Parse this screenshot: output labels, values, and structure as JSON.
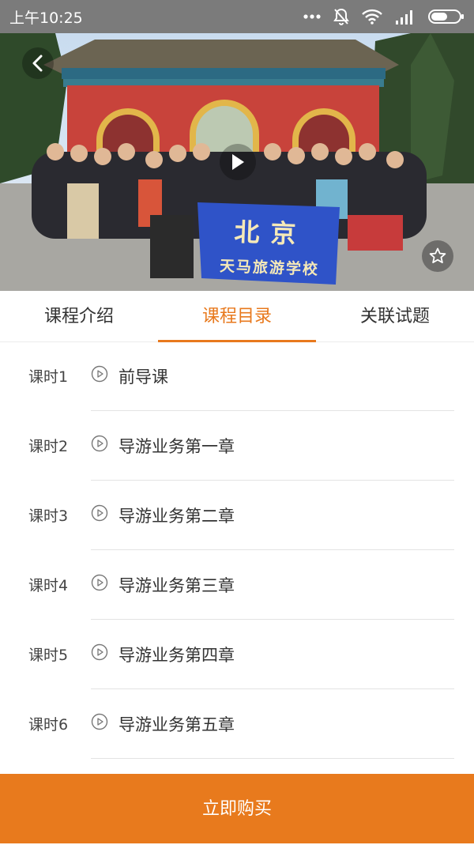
{
  "status_bar": {
    "time": "上午10:25",
    "icons": [
      "more-dots-icon",
      "mute-bell-icon",
      "wifi-icon",
      "signal-icon",
      "battery-icon"
    ]
  },
  "hero": {
    "banner_text_line1": "北京",
    "banner_text_line2": "天马旅游学校",
    "icons": [
      "back-arrow-icon",
      "play-icon",
      "star-icon"
    ]
  },
  "tabs": [
    {
      "label": "课程介绍",
      "active": false
    },
    {
      "label": "课程目录",
      "active": true
    },
    {
      "label": "关联试题",
      "active": false
    }
  ],
  "lessons": [
    {
      "number": "课时1",
      "title": "前导课"
    },
    {
      "number": "课时2",
      "title": "导游业务第一章"
    },
    {
      "number": "课时3",
      "title": "导游业务第二章"
    },
    {
      "number": "课时4",
      "title": "导游业务第三章"
    },
    {
      "number": "课时5",
      "title": "导游业务第四章"
    },
    {
      "number": "课时6",
      "title": "导游业务第五章"
    }
  ],
  "buy_button": {
    "label": "立即购买"
  },
  "colors": {
    "accent": "#e87a1d",
    "status_bar": "#7b7b7b"
  }
}
